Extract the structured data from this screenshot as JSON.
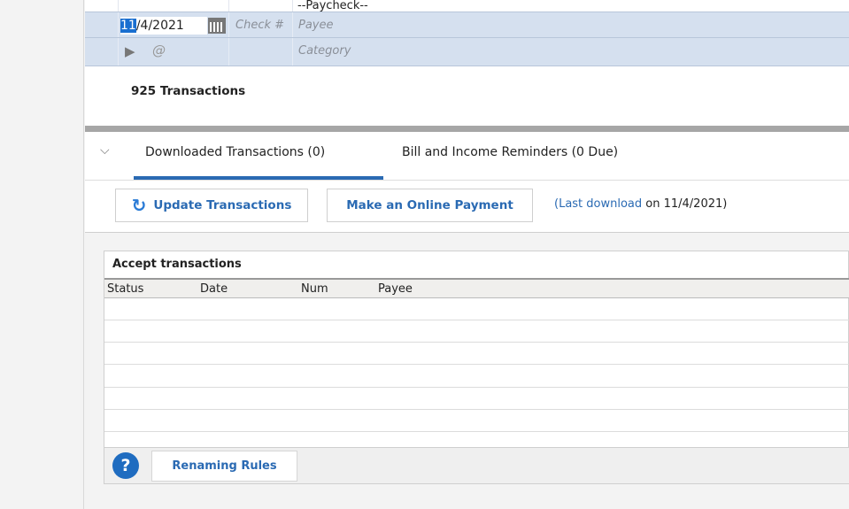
{
  "register": {
    "prev_payee": "--Paycheck--",
    "date_value": "11/4/2021",
    "date_selected": "11",
    "date_rest": "/4/2021",
    "check_placeholder": "Check #",
    "payee_placeholder": "Payee",
    "category_placeholder": "Category",
    "count_label": "925 Transactions"
  },
  "tabs": [
    {
      "label": "Downloaded Transactions (0)",
      "active": true
    },
    {
      "label": "Bill and Income Reminders (0 Due)",
      "active": false
    }
  ],
  "actions": {
    "update": "Update Transactions",
    "payment": "Make an Online Payment",
    "last_prefix": "(",
    "last_link": "Last download",
    "last_suffix": " on 11/4/2021)"
  },
  "accept": {
    "title": "Accept transactions",
    "columns": [
      "Status",
      "Date",
      "Num",
      "Payee"
    ],
    "renaming_rules": "Renaming Rules"
  },
  "colors": {
    "accent": "#2a6ab3",
    "row_highlight": "#d5e0ef"
  }
}
